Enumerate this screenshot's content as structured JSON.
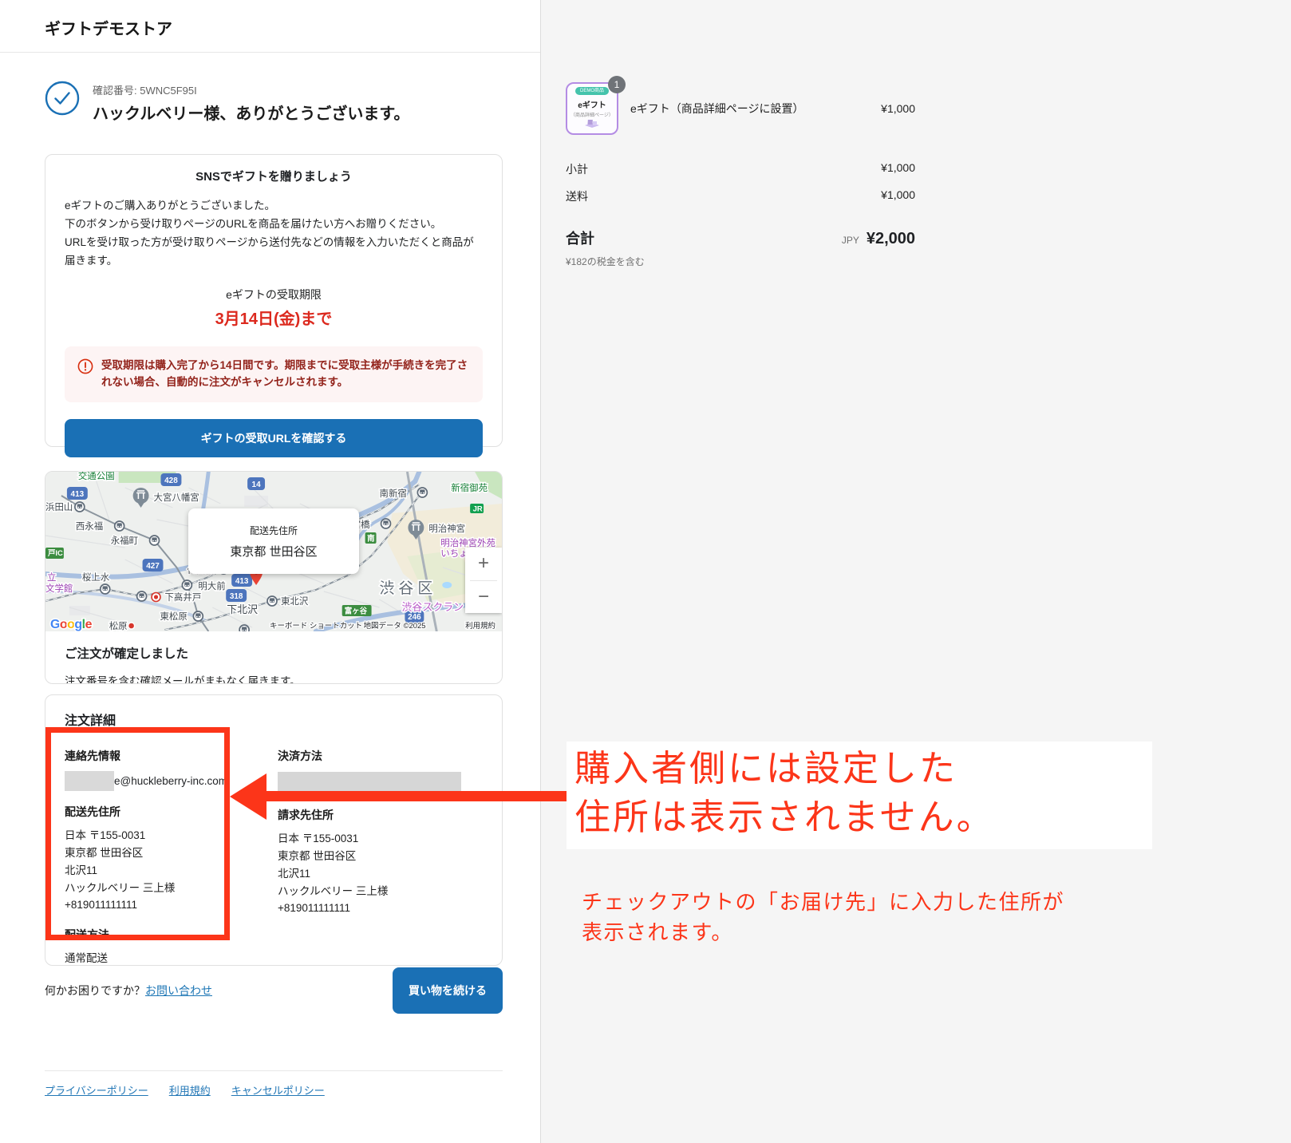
{
  "header": {
    "store_name": "ギフトデモストア"
  },
  "confirmation": {
    "number": "確認番号: 5WNC5F95I",
    "title": "ハックルベリー様、ありがとうございます。"
  },
  "icons": {
    "confirmation_check": "check-circle-icon",
    "warning": "alert-circle-icon",
    "map_pin": "map-pin-icon"
  },
  "gift_card": {
    "title": "SNSでギフトを贈りましょう",
    "body_line1": "eギフトのご購入ありがとうございました。",
    "body_line2": "下のボタンから受け取りページのURLを商品を届けたい方へお贈りください。",
    "body_line3": "URLを受け取った方が受け取りページから送付先などの情報を入力いただくと商品が届きます。",
    "deadline_label": "eギフトの受取期限",
    "deadline_value": "3月14日(金)まで",
    "warning_text": "受取期限は購入完了から14日間です。期限までに受取主様が手続きを完了されない場合、自動的に注文がキャンセルされます。",
    "button_label": "ギフトの受取URLを確認する"
  },
  "map": {
    "overlay": {
      "title": "配送先住所",
      "value": "東京都 世田谷区"
    },
    "zoom_in": "+",
    "zoom_out": "−",
    "google_logo": "Google",
    "attribution": {
      "keyboard": "キーボード ショートカット",
      "data": "地図データ ©2025",
      "terms": "利用規約"
    },
    "labels": {
      "kotsu_koen": "交通公園",
      "omiya_hachimangu": "大宮八幡宮",
      "minami_shinjuku": "南新宿",
      "shinjuku_gyoen": "新宿御苑",
      "jr": "JR",
      "miyabashi": "宮橋",
      "minami": "南",
      "meiji_jingu": "明治神宮",
      "meiji_jingu_gaien": "明治神宮外苑",
      "icho": "いちょ",
      "hamadayama": "浜田山",
      "nishi_eifuku": "西永福",
      "eifukucho": "永福町",
      "to_ic": "戸IC",
      "daitabashi": "代田橋",
      "meidaimae": "明大前",
      "sakurajosui": "桜上水",
      "tatsu": "立",
      "bungakukan": "文学館",
      "shimotakaido": "下高井戸",
      "shimokitazawa": "下北沢",
      "higashi_kitazawa": "東北沢",
      "higashi_matsubara": "東松原",
      "matsubara": "松原",
      "shibuya_ku": "渋谷区",
      "shibuya_scramble": "渋谷スクラン",
      "tomigaya": "富ヶ谷"
    },
    "shields": {
      "r413a": "413",
      "r428": "428",
      "r14": "14",
      "r427": "427",
      "r413b": "413",
      "r318": "318",
      "r246": "246"
    }
  },
  "order_confirmed": {
    "title": "ご注文が確定しました",
    "body": "注文番号を含む確認メールがまもなく届きます。"
  },
  "order_details": {
    "title": "注文詳細",
    "contact_label": "連絡先情報",
    "contact_email_visible": "e@huckleberry-inc.com",
    "shipping_address_label": "配送先住所",
    "shipping_address_lines": [
      "日本 〒155-0031",
      "東京都 世田谷区",
      "北沢11",
      "ハックルベリー 三上様",
      "+819011111111"
    ],
    "shipping_method_label": "配送方法",
    "shipping_method_value": "通常配送",
    "payment_label": "決済方法",
    "billing_address_label": "請求先住所",
    "billing_address_lines": [
      "日本 〒155-0031",
      "東京都 世田谷区",
      "北沢11",
      "ハックルベリー 三上様",
      "+819011111111"
    ]
  },
  "footer": {
    "help_text": "何かお困りですか？",
    "contact_link": "お問い合わせ",
    "continue_button": "買い物を続ける",
    "link_privacy": "プライバシーポリシー",
    "link_terms": "利用規約",
    "link_cancel": "キャンセルポリシー"
  },
  "summary": {
    "item": {
      "thumb_badge": "DEMO商品",
      "thumb_title": "eギフト",
      "thumb_subtitle": "（商品詳細ページ）",
      "quantity": "1",
      "name": "eギフト（商品詳細ページに設置）",
      "price": "¥1,000"
    },
    "subtotal_label": "小計",
    "subtotal_value": "¥1,000",
    "shipping_label": "送料",
    "shipping_value": "¥1,000",
    "total_label": "合計",
    "currency": "JPY",
    "total_value": "¥2,000",
    "tax_note": "¥182の税金を含む"
  },
  "annotation": {
    "main_line1": "購入者側には設定した",
    "main_line2": "住所は表示されません。",
    "sub_line1": "チェックアウトの「お届け先」に入力した住所が",
    "sub_line2": "表示されます。"
  },
  "colors": {
    "accent_blue": "#1a70b5",
    "alert_red": "#dc291e",
    "annotation_red": "#fc3519",
    "panel_gray": "#f5f5f5",
    "google_letters": [
      "#4285F4",
      "#EA4335",
      "#FBBC05",
      "#4285F4",
      "#34A853",
      "#EA4335"
    ]
  }
}
